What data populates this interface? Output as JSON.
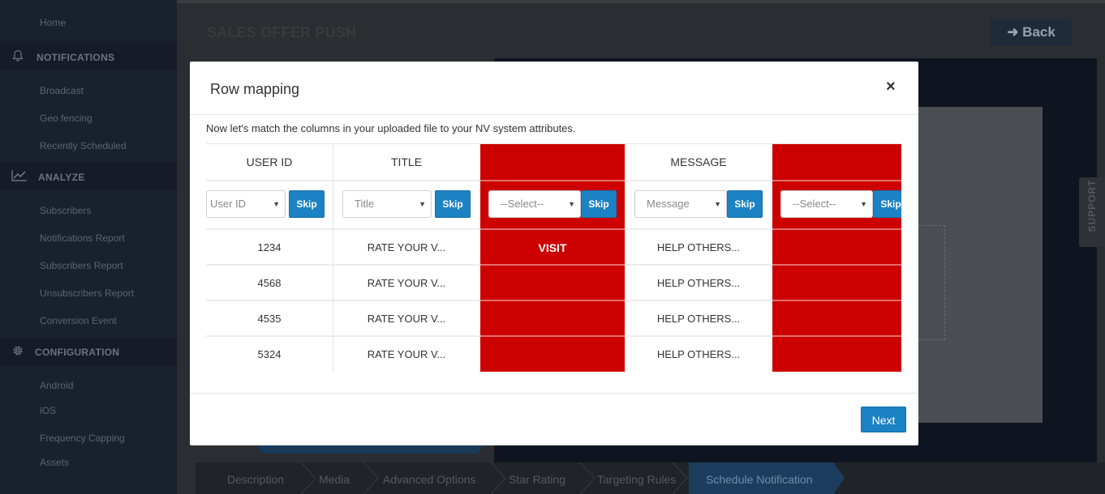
{
  "sidebar": {
    "home": "Home",
    "notifications": "NOTIFICATIONS",
    "broadcast": "Broadcast",
    "geo_fencing": "Geo fencing",
    "recently_scheduled": "Recently Scheduled",
    "analyze": "ANALYZE",
    "subscribers": "Subscribers",
    "notifications_report": "Notifications Report",
    "subscribers_report": "Subscribers Report",
    "unsubscribers_report": "Unsubscribers Report",
    "conversion_event": "Conversion Event",
    "configuration": "CONFIGURATION",
    "android": "Android",
    "ios": "iOS",
    "frequency_capping": "Frequency Capping",
    "assets": "Assets"
  },
  "page": {
    "title": "SALES OFFER PUSH",
    "back_label": "Back",
    "support_label": "SUPPORT"
  },
  "steps": [
    "Description",
    "Media",
    "Advanced Options",
    "Star Rating",
    "Targeting Rules",
    "Schedule Notification"
  ],
  "modal": {
    "title": "Row mapping",
    "close": "×",
    "description": "Now let's match the columns in your uploaded file to your NV system attributes.",
    "next_label": "Next",
    "skip_label": "Skip",
    "columns": [
      {
        "header": "USER ID",
        "select": "User ID",
        "values": [
          "1234",
          "4568",
          "4535",
          "5324"
        ]
      },
      {
        "header": "TITLE",
        "select": "Title",
        "values": [
          "RATE YOUR V...",
          "RATE YOUR V...",
          "RATE YOUR V...",
          "RATE YOUR V..."
        ]
      },
      {
        "header": "",
        "select": "--Select--",
        "values": [
          "VISIT",
          "",
          "",
          ""
        ]
      },
      {
        "header": "MESSAGE",
        "select": "Message",
        "values": [
          "HELP OTHERS...",
          "HELP OTHERS...",
          "HELP OTHERS...",
          "HELP OTHERS..."
        ]
      },
      {
        "header": "",
        "select": "--Select--",
        "values": [
          "",
          "",
          "",
          ""
        ]
      }
    ]
  },
  "colors": {
    "skipped_column": "#cd0000",
    "primary_button": "#1b82c4"
  }
}
